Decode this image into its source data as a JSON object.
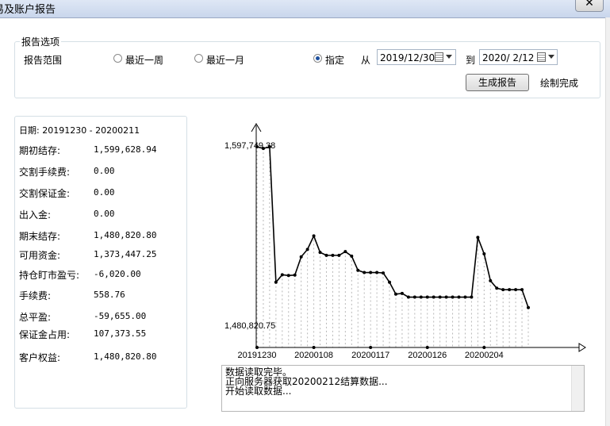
{
  "window": {
    "title": "易及账户报告",
    "close_glyph": "✕"
  },
  "options": {
    "group_title": "报告选项",
    "range_label": "报告范围",
    "radios": [
      {
        "label": "最近一周",
        "checked": false
      },
      {
        "label": "最近一月",
        "checked": false
      },
      {
        "label": "指定",
        "checked": true
      }
    ],
    "from_label": "从",
    "from_date": "2019/12/30",
    "to_label": "到",
    "to_date": "2020/ 2/12",
    "generate_button": "生成报告",
    "status": "绘制完成"
  },
  "summary": {
    "date_range": "日期: 20191230 - 20200211",
    "rows": [
      {
        "label": "期初结存:",
        "value": "1,599,628.94"
      },
      {
        "label": "交割手续费:",
        "value": "0.00"
      },
      {
        "label": "交割保证金:",
        "value": "0.00"
      },
      {
        "label": "出入金:",
        "value": "0.00"
      },
      {
        "label": "期末结存:",
        "value": "1,480,820.80"
      },
      {
        "label": "可用资金:",
        "value": "1,373,447.25"
      },
      {
        "label": "持仓盯市盈亏:",
        "value": "-6,020.00"
      },
      {
        "label": "手续费:",
        "value": "558.76"
      },
      {
        "label": "总平盈:",
        "value": "-59,655.00"
      },
      {
        "label": "保证金占用:",
        "value": "107,373.55"
      },
      {
        "label": "客户权益:",
        "value": "1,480,820.80"
      }
    ]
  },
  "chart_data": {
    "type": "line",
    "title": "",
    "xlabel": "",
    "ylabel": "",
    "series": [
      {
        "values": [
          1597749.38,
          1596600,
          1597749.38,
          1507000,
          1512000,
          1511500,
          1511800,
          1524000,
          1529000,
          1538000,
          1527000,
          1525000,
          1525000,
          1525000,
          1527500,
          1524500,
          1515000,
          1513500,
          1513500,
          1513500,
          1513200,
          1507000,
          1499000,
          1499500,
          1497000,
          1497000,
          1497000,
          1497000,
          1497000,
          1497000,
          1497000,
          1497000,
          1497000,
          1497000,
          1497000,
          1537000,
          1526000,
          1508000,
          1503000,
          1502000,
          1502000,
          1502000,
          1502000,
          1490000
        ]
      }
    ],
    "y_labels": {
      "max": "1,597,749.38",
      "min": "1,480,820.75"
    },
    "ylim": [
      1480820.75,
      1597749.38
    ],
    "x_tick_labels": [
      "20191230",
      "20200108",
      "20200117",
      "20200126",
      "20200204"
    ],
    "grid": "vertical dashed"
  },
  "log": {
    "lines": [
      "数据读取完毕。",
      "正向服务器获取20200212结算数据...",
      "开始读取数据..."
    ]
  }
}
